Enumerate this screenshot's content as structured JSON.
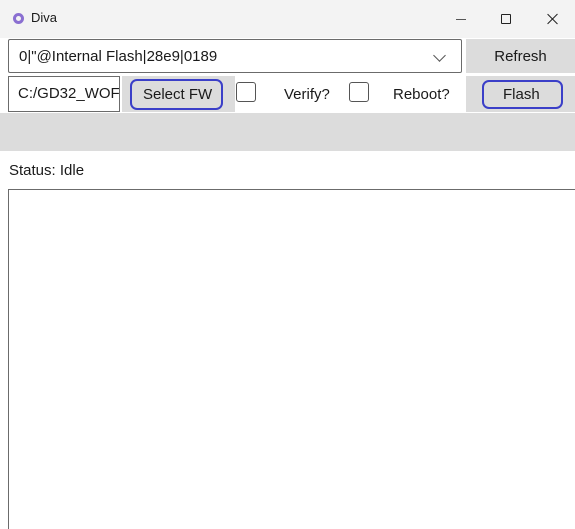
{
  "window": {
    "title": "Diva",
    "icon": "app-logo-icon",
    "controls": {
      "minimize": "minimize-icon",
      "maximize": "maximize-icon",
      "close": "close-icon"
    }
  },
  "device": {
    "selected": "0|\"@Internal Flash|28e9|0189",
    "dropdown_icon": "chevron-down-icon"
  },
  "toolbar": {
    "refresh_label": "Refresh",
    "firmware_path": "C:/GD32_WOF",
    "select_fw_label": "Select FW",
    "verify_label": "Verify?",
    "verify_checked": false,
    "reboot_label": "Reboot?",
    "reboot_checked": false,
    "flash_label": "Flash"
  },
  "status": {
    "text": "Status: Idle"
  },
  "log": {
    "content": ""
  },
  "colors": {
    "highlight_outline": "#3b3fc8",
    "button_gray": "#dcdcdc",
    "title_bar": "#f3f3f3"
  }
}
